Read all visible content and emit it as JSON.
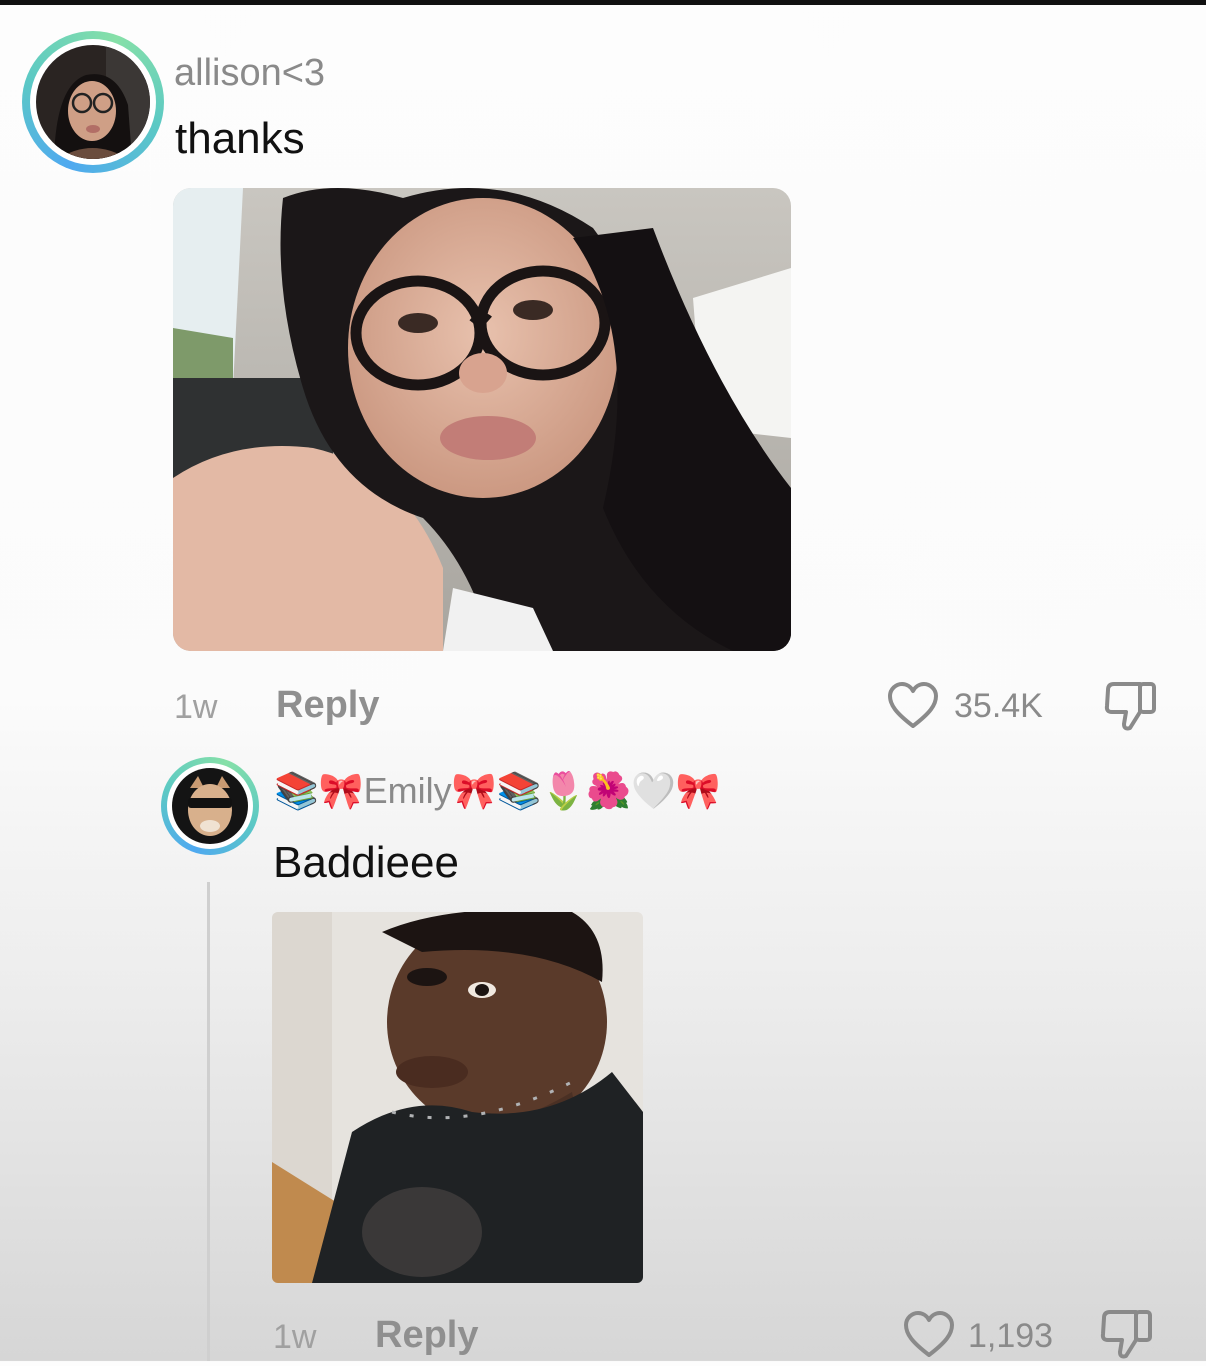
{
  "colors": {
    "accent_ring": "#5cc9c4",
    "username": "#8a8a8a",
    "meta": "#a0a0a0"
  },
  "comments": [
    {
      "username": "allison<3",
      "text": "thanks",
      "time": "1w",
      "reply_label": "Reply",
      "likes": "35.4K",
      "icons": {
        "like": "heart-outline-icon",
        "dislike": "thumbs-down-icon"
      }
    },
    {
      "username_prefix": "📚🎀",
      "username_name": "Emily",
      "username_suffix": "🎀📚🌷🌺🤍🎀",
      "text": "Baddieee",
      "time": "1w",
      "reply_label": "Reply",
      "likes": "1,193",
      "icons": {
        "like": "heart-outline-icon",
        "dislike": "thumbs-down-icon"
      }
    }
  ]
}
